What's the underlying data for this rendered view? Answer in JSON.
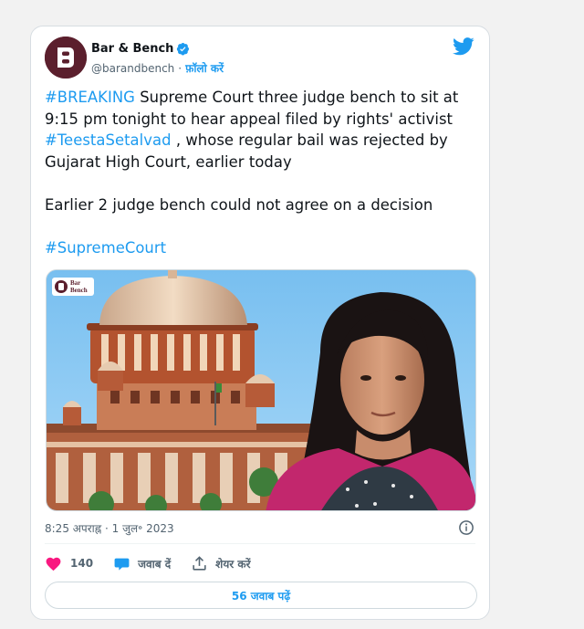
{
  "author": {
    "name": "Bar & Bench",
    "handle": "@barandbench",
    "follow_label": "फ़ॉलो करें",
    "separator": "·"
  },
  "tweet": {
    "hashtag_breaking": "#BREAKING",
    "line1_rest": " Supreme Court three judge bench to sit at 9:15 pm tonight to hear  appeal filed by rights' activist ",
    "hashtag_teesta": "#TeestaSetalvad",
    "line1_end": " , whose regular bail was rejected by Gujarat High Court, earlier today",
    "paragraph2": "Earlier 2 judge bench could not agree on a decision",
    "hashtag_sc": "#SupremeCourt"
  },
  "media": {
    "logo_text_line1": "Bar",
    "logo_text_line2": "Bench"
  },
  "meta": {
    "timestamp": "8:25 अपराह्न · 1 जुल॰ 2023"
  },
  "actions": {
    "like_count": "140",
    "reply_label": "जवाब दें",
    "share_label": "शेयर करें"
  },
  "replies_button": {
    "label": "56 जवाब पढ़ें"
  },
  "colors": {
    "accent": "#1d9bf0",
    "like": "#f91880",
    "avatar_bg": "#5b1f2d",
    "sky": "#7ec3f3"
  }
}
